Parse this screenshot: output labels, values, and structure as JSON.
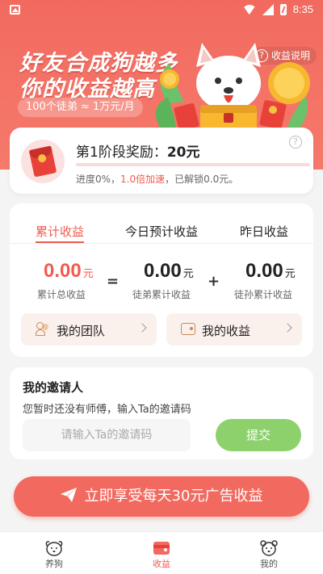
{
  "status_bar": {
    "time": "8:35"
  },
  "banner": {
    "headline_line1": "好友合成狗越多",
    "headline_line2": "你的收益越高",
    "subtitle": "100个徒弟 ≈ 1万元/月",
    "help_label": "收益说明"
  },
  "stage": {
    "title_prefix": "第1阶段奖励：",
    "reward": "20元",
    "progress_percent": 0,
    "progress_text_prefix": "进度0%，",
    "progress_text_highlight": "1.0倍加速",
    "progress_text_suffix": "，已解锁0.0元。"
  },
  "earnings": {
    "tabs": [
      {
        "label": "累计收益"
      },
      {
        "label": "今日预计收益"
      },
      {
        "label": "昨日收益"
      }
    ],
    "total": {
      "value": "0.00",
      "unit": "元",
      "label": "累计总收益"
    },
    "op_equals": "=",
    "disciples": {
      "value": "0.00",
      "unit": "元",
      "label": "徒弟累计收益"
    },
    "op_plus": "+",
    "grand_disciples": {
      "value": "0.00",
      "unit": "元",
      "label": "徒孙累计收益"
    },
    "my_team_label": "我的团队",
    "my_earnings_label": "我的收益"
  },
  "inviter": {
    "title": "我的邀请人",
    "description": "您暂时还没有师傅，输入Ta的邀请码",
    "input_placeholder": "请输入Ta的邀请码",
    "input_value": "",
    "submit_label": "提交"
  },
  "cta": {
    "label": "立即享受每天30元广告收益"
  },
  "nav": [
    {
      "label": "养狗",
      "icon": "dog-face-icon"
    },
    {
      "label": "收益",
      "icon": "wallet-icon",
      "active": true
    },
    {
      "label": "我的",
      "icon": "bear-face-icon"
    }
  ],
  "colors": {
    "accent": "#f26a5f",
    "accent_text": "#f25a4e",
    "submit_green": "#8dd16c"
  }
}
